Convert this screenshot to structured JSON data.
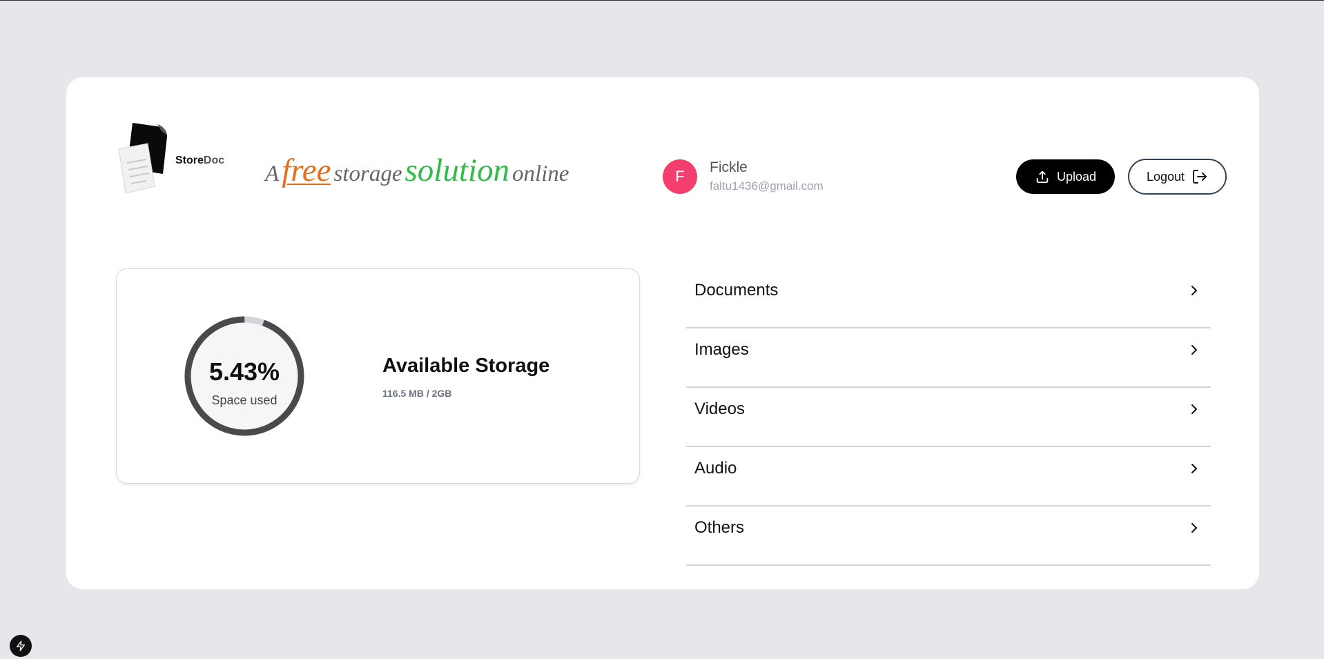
{
  "header": {
    "logo_word_1": "Store",
    "logo_word_2": "Doc",
    "tagline": {
      "w1": "A",
      "w2": "free",
      "w3": "storage",
      "w4": "solution",
      "w5": "online"
    }
  },
  "user": {
    "initial": "F",
    "name": "Fickle",
    "email": "faltu1436@gmail.com"
  },
  "actions": {
    "upload_label": "Upload",
    "logout_label": "Logout"
  },
  "storage": {
    "percent_text": "5.43%",
    "percent_value": 5.43,
    "used_label": "Space used",
    "title": "Available Storage",
    "usage": "116.5 MB / 2GB"
  },
  "categories": [
    {
      "label": "Documents"
    },
    {
      "label": "Images"
    },
    {
      "label": "Videos"
    },
    {
      "label": "Audio"
    },
    {
      "label": "Others"
    }
  ],
  "colors": {
    "accent_avatar": "#f43f6e",
    "tagline_free": "#ea6e1a",
    "tagline_solution": "#2fbd47"
  },
  "icons": [
    "upload-icon",
    "logout-icon",
    "chevron-right-icon",
    "bolt-icon",
    "document-logo-icon"
  ]
}
